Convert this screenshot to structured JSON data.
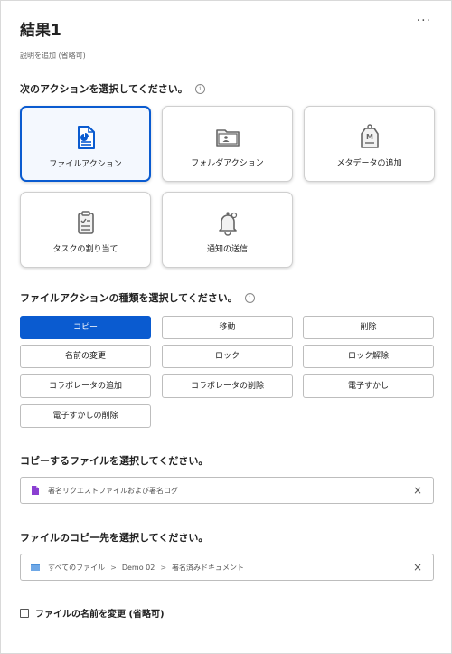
{
  "header": {
    "title": "結果1",
    "more_label": "···",
    "description": "説明を追加 (省略可)"
  },
  "action_section": {
    "label": "次のアクションを選択してください。",
    "info": "i",
    "cards": [
      {
        "label": "ファイルアクション",
        "icon": "file-icon",
        "selected": true
      },
      {
        "label": "フォルダアクション",
        "icon": "folder-icon",
        "selected": false
      },
      {
        "label": "メタデータの追加",
        "icon": "tag-icon",
        "selected": false
      },
      {
        "label": "タスクの割り当て",
        "icon": "clipboard-icon",
        "selected": false
      },
      {
        "label": "通知の送信",
        "icon": "bell-icon",
        "selected": false
      }
    ]
  },
  "type_section": {
    "label": "ファイルアクションの種類を選択してください。",
    "info": "i",
    "options": [
      {
        "label": "コピー",
        "active": true
      },
      {
        "label": "移動",
        "active": false
      },
      {
        "label": "削除",
        "active": false
      },
      {
        "label": "名前の変更",
        "active": false
      },
      {
        "label": "ロック",
        "active": false
      },
      {
        "label": "ロック解除",
        "active": false
      },
      {
        "label": "コラボレータの追加",
        "active": false
      },
      {
        "label": "コラボレータの削除",
        "active": false
      },
      {
        "label": "電子すかし",
        "active": false
      },
      {
        "label": "電子すかしの削除",
        "active": false
      }
    ]
  },
  "file_select": {
    "label": "コピーするファイルを選択してください。",
    "value": "署名リクエストファイルおよび署名ログ",
    "clear": "×"
  },
  "destination": {
    "label": "ファイルのコピー先を選択してください。",
    "path": [
      "すべてのファイル",
      "Demo 02",
      "署名済みドキュメント"
    ],
    "separator": ">",
    "clear": "×"
  },
  "rename": {
    "label": "ファイルの名前を変更 (省略可)",
    "checked": false
  },
  "colors": {
    "accent": "#0a5bd0",
    "file_icon": "#8a3fd1",
    "folder_icon": "#4a90d9"
  }
}
